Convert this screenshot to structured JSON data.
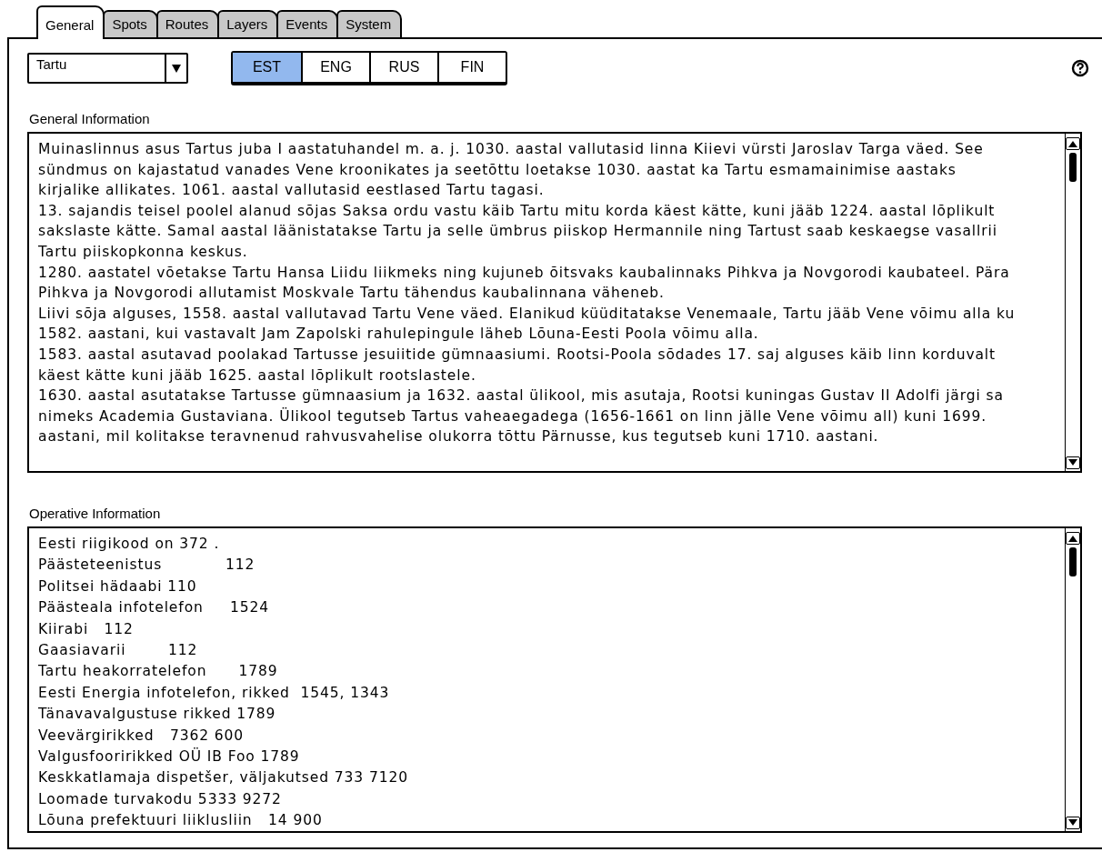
{
  "tabs": [
    {
      "label": "General",
      "selected": true
    },
    {
      "label": "Spots",
      "selected": false
    },
    {
      "label": "Routes",
      "selected": false
    },
    {
      "label": "Layers",
      "selected": false
    },
    {
      "label": "Events",
      "selected": false
    },
    {
      "label": "System",
      "selected": false
    }
  ],
  "city_select": {
    "value": "Tartu"
  },
  "languages": [
    {
      "label": "EST",
      "selected": true
    },
    {
      "label": "ENG",
      "selected": false
    },
    {
      "label": "RUS",
      "selected": false
    },
    {
      "label": "FIN",
      "selected": false
    }
  ],
  "general_information": {
    "label": "General Information",
    "lines": [
      "Muinaslinnus asus Tartus juba I aastatuhandel m. a. j. 1030. aastal vallutasid linna Kiievi vürsti Jaroslav Targa väed. See",
      "sündmus on kajastatud vanades Vene kroonikates ja seetõttu loetakse 1030. aastat ka Tartu esmamainimise aastaks",
      "kirjalike allikates. 1061. aastal vallutasid eestlased Tartu tagasi.",
      "13. sajandis teisel poolel alanud sõjas Saksa ordu vastu käib Tartu mitu korda käest kätte, kuni jääb 1224. aastal lõplikult",
      "sakslaste kätte. Samal aastal läänistatakse Tartu ja selle ümbrus piiskop Hermannile ning Tartust saab keskaegse vasallrii",
      "Tartu piiskopkonna keskus.",
      "1280. aastatel võetakse Tartu Hansa Liidu liikmeks ning kujuneb õitsvaks kaubalinnaks Pihkva ja Novgorodi kaubateel. Pära",
      "Pihkva ja Novgorodi allutamist Moskvale Tartu tähendus kaubalinnana väheneb.",
      "Liivi sõja alguses, 1558. aastal vallutavad Tartu Vene väed. Elanikud küüditatakse Venemaale, Tartu jääb Vene võimu alla ku",
      "1582. aastani, kui vastavalt Jam Zapolski rahulepingule läheb Lõuna-Eesti Poola võimu alla.",
      "1583. aastal asutavad poolakad Tartusse jesuiitide gümnaasiumi. Rootsi-Poola sõdades 17. saj alguses käib linn korduvalt",
      "käest kätte kuni jääb 1625. aastal lõplikult rootslastele.",
      "1630. aastal asutatakse Tartusse gümnaasium ja 1632. aastal ülikool, mis asutaja, Rootsi kuningas Gustav II Adolfi järgi sa",
      "nimeks Academia Gustaviana. Ülikool tegutseb Tartus vaheaegadega (1656-1661 on linn jälle Vene võimu all) kuni 1699.",
      "aastani, mil kolitakse teravnenud rahvusvahelise olukorra tõttu Pärnusse, kus tegutseb kuni 1710. aastani."
    ]
  },
  "operative_information": {
    "label": "Operative Information",
    "lines": [
      "Eesti riigikood on 372 .",
      "Päästeteenistus            112",
      "Politsei hädaabi 110",
      "Päästeala infotelefon     1524",
      "Kiirabi   112",
      "Gaasiavarii        112",
      "Tartu heakorratelefon      1789",
      "Eesti Energia infotelefon, rikked  1545, 1343",
      "Tänavavalgustuse rikked 1789",
      "Veevärgirikked   7362 600",
      "Valgusfooririkked OÜ IB Foo 1789",
      "Keskkatlamaja dispetšer, väljakutsed 733 7120",
      "Loomade turvakodu 5333 9272",
      "Lõuna prefektuuri liiklusliin   14 900"
    ]
  }
}
